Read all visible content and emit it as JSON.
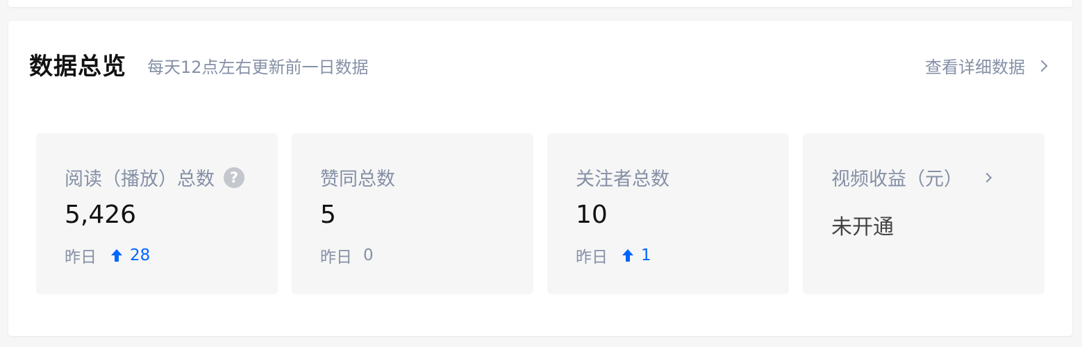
{
  "overview": {
    "title": "数据总览",
    "subtitle": "每天12点左右更新前一日数据",
    "detail_link": "查看详细数据"
  },
  "stats": [
    {
      "label": "阅读（播放）总数",
      "value": "5,426",
      "delta_label": "昨日",
      "delta": "28",
      "trend": "up"
    },
    {
      "label": "赞同总数",
      "value": "5",
      "delta_label": "昨日",
      "delta": "0",
      "trend": "flat"
    },
    {
      "label": "关注者总数",
      "value": "10",
      "delta_label": "昨日",
      "delta": "1",
      "trend": "up"
    },
    {
      "label": "视频收益（元）",
      "status": "未开通"
    }
  ],
  "colors": {
    "accent": "#0066ff",
    "muted": "#8590a6",
    "card_bg": "#f6f6f6"
  },
  "icons": [
    "help-icon",
    "chevron-right-icon",
    "arrow-up-icon"
  ]
}
